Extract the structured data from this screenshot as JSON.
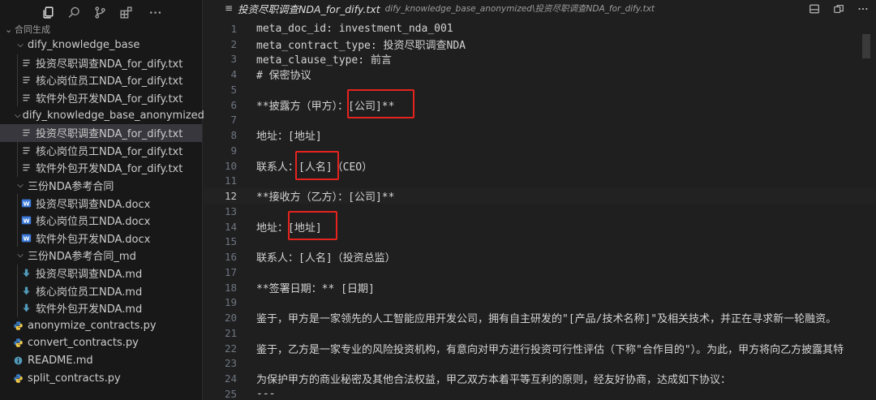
{
  "activity": {
    "icons": [
      "explorer-icon",
      "search-icon",
      "source-control-icon",
      "extensions-icon",
      "more-icon"
    ]
  },
  "explorer": {
    "section_title": "合同生成",
    "items": [
      {
        "label": "dify_knowledge_base",
        "type": "folder",
        "depth": 0
      },
      {
        "label": "投资尽职调查NDA_for_dify.txt",
        "type": "txt",
        "depth": 1
      },
      {
        "label": "核心岗位员工NDA_for_dify.txt",
        "type": "txt",
        "depth": 1
      },
      {
        "label": "软件外包开发NDA_for_dify.txt",
        "type": "txt",
        "depth": 1
      },
      {
        "label": "dify_knowledge_base_anonymized",
        "type": "folder",
        "depth": 0
      },
      {
        "label": "投资尽职调查NDA_for_dify.txt",
        "type": "txt",
        "depth": 1,
        "selected": true
      },
      {
        "label": "核心岗位员工NDA_for_dify.txt",
        "type": "txt",
        "depth": 1
      },
      {
        "label": "软件外包开发NDA_for_dify.txt",
        "type": "txt",
        "depth": 1
      },
      {
        "label": "三份NDA参考合同",
        "type": "folder",
        "depth": 0
      },
      {
        "label": "投资尽职调查NDA.docx",
        "type": "docx",
        "depth": 1
      },
      {
        "label": "核心岗位员工NDA.docx",
        "type": "docx",
        "depth": 1
      },
      {
        "label": "软件外包开发NDA.docx",
        "type": "docx",
        "depth": 1
      },
      {
        "label": "三份NDA参考合同_md",
        "type": "folder",
        "depth": 0
      },
      {
        "label": "投资尽职调查NDA.md",
        "type": "md",
        "depth": 1
      },
      {
        "label": "核心岗位员工NDA.md",
        "type": "md",
        "depth": 1
      },
      {
        "label": "软件外包开发NDA.md",
        "type": "md",
        "depth": 1
      },
      {
        "label": "anonymize_contracts.py",
        "type": "py",
        "depth": 0
      },
      {
        "label": "convert_contracts.py",
        "type": "py",
        "depth": 0
      },
      {
        "label": "README.md",
        "type": "readme",
        "depth": 0
      },
      {
        "label": "split_contracts.py",
        "type": "py",
        "depth": 0
      }
    ]
  },
  "tab": {
    "title": "投资尽职调查NDA_for_dify.txt",
    "path": "dify_knowledge_base_anonymized\\投资尽职调查NDA_for_dify.txt"
  },
  "editor": {
    "current_line": 12,
    "lines": [
      {
        "n": "1",
        "text": "meta_doc_id: investment_nda_001"
      },
      {
        "n": "2",
        "text": "meta_contract_type: 投资尽职调查NDA"
      },
      {
        "n": "3",
        "text": "meta_clause_type: 前言"
      },
      {
        "n": "4",
        "text": "# 保密协议"
      },
      {
        "n": "5",
        "text": ""
      },
      {
        "n": "6",
        "text": "**披露方（甲方）：[公司]**"
      },
      {
        "n": "7",
        "text": ""
      },
      {
        "n": "8",
        "text": "地址：[地址]"
      },
      {
        "n": "9",
        "text": ""
      },
      {
        "n": "10",
        "text": "联系人：[人名]（CEO）"
      },
      {
        "n": "11",
        "text": ""
      },
      {
        "n": "12",
        "text": "**接收方（乙方）：[公司]**"
      },
      {
        "n": "13",
        "text": ""
      },
      {
        "n": "14",
        "text": "地址：[地址]"
      },
      {
        "n": "15",
        "text": ""
      },
      {
        "n": "16",
        "text": "联系人：[人名]（投资总监）"
      },
      {
        "n": "17",
        "text": ""
      },
      {
        "n": "18",
        "text": "**签署日期：** [日期]"
      },
      {
        "n": "19",
        "text": ""
      },
      {
        "n": "20",
        "text": "鉴于，甲方是一家领先的人工智能应用开发公司，拥有自主研发的\"[产品/技术名称]\"及相关技术，并正在寻求新一轮融资。"
      },
      {
        "n": "21",
        "text": ""
      },
      {
        "n": "22",
        "text": "鉴于，乙方是一家专业的风险投资机构，有意向对甲方进行投资可行性评估（下称\"合作目的\"）。为此，甲方将向乙方披露其特"
      },
      {
        "n": "23",
        "text": ""
      },
      {
        "n": "24",
        "text": "为保护甲方的商业秘密及其他合法权益，甲乙双方本着平等互利的原则，经友好协商，达成如下协议："
      },
      {
        "n": "25",
        "text": "---"
      }
    ]
  }
}
